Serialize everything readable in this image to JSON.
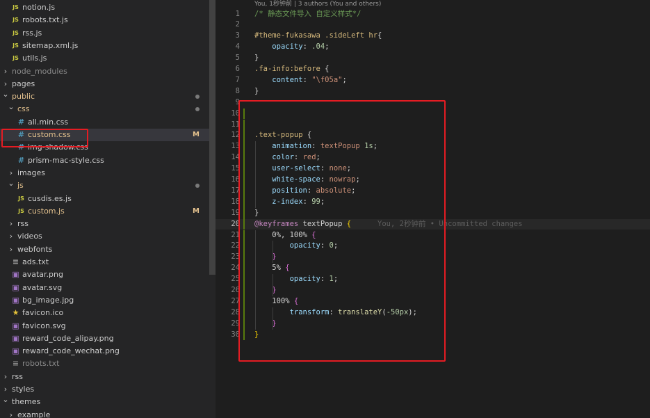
{
  "explorer": {
    "items": [
      {
        "type": "file",
        "depth": 1,
        "icon": "js-file-icon",
        "icon_text": "JS",
        "color": "#cbcb41",
        "label": "notion.js"
      },
      {
        "type": "file",
        "depth": 1,
        "icon": "js-file-icon",
        "icon_text": "JS",
        "color": "#cbcb41",
        "label": "robots.txt.js"
      },
      {
        "type": "file",
        "depth": 1,
        "icon": "js-file-icon",
        "icon_text": "JS",
        "color": "#cbcb41",
        "label": "rss.js"
      },
      {
        "type": "file",
        "depth": 1,
        "icon": "js-file-icon",
        "icon_text": "JS",
        "color": "#cbcb41",
        "label": "sitemap.xml.js"
      },
      {
        "type": "file",
        "depth": 1,
        "icon": "js-file-icon",
        "icon_text": "JS",
        "color": "#cbcb41",
        "label": "utils.js"
      },
      {
        "type": "folder",
        "depth": 0,
        "open": false,
        "label": "node_modules",
        "muted": true
      },
      {
        "type": "folder",
        "depth": 0,
        "open": false,
        "label": "pages"
      },
      {
        "type": "folder",
        "depth": 0,
        "open": true,
        "label": "public",
        "dot": true,
        "labelColor": "#e2c08d"
      },
      {
        "type": "folder",
        "depth": 1,
        "open": true,
        "label": "css",
        "dot": true,
        "labelColor": "#e2c08d"
      },
      {
        "type": "file",
        "depth": 2,
        "icon": "css-file-icon",
        "icon_text": "#",
        "color": "#519aba",
        "label": "all.min.css"
      },
      {
        "type": "file",
        "depth": 2,
        "icon": "css-file-icon",
        "icon_text": "#",
        "color": "#519aba",
        "label": "custom.css",
        "selected": true,
        "deco": "M",
        "labelColor": "#e2c08d"
      },
      {
        "type": "file",
        "depth": 2,
        "icon": "css-file-icon",
        "icon_text": "#",
        "color": "#519aba",
        "label": "img-shadow.css"
      },
      {
        "type": "file",
        "depth": 2,
        "icon": "css-file-icon",
        "icon_text": "#",
        "color": "#519aba",
        "label": "prism-mac-style.css"
      },
      {
        "type": "folder",
        "depth": 1,
        "open": false,
        "label": "images"
      },
      {
        "type": "folder",
        "depth": 1,
        "open": true,
        "label": "js",
        "dot": true,
        "labelColor": "#e2c08d"
      },
      {
        "type": "file",
        "depth": 2,
        "icon": "js-file-icon",
        "icon_text": "JS",
        "color": "#cbcb41",
        "label": "cusdis.es.js"
      },
      {
        "type": "file",
        "depth": 2,
        "icon": "js-file-icon",
        "icon_text": "JS",
        "color": "#cbcb41",
        "label": "custom.js",
        "deco": "M",
        "labelColor": "#e2c08d"
      },
      {
        "type": "folder",
        "depth": 1,
        "open": false,
        "label": "rss"
      },
      {
        "type": "folder",
        "depth": 1,
        "open": false,
        "label": "videos"
      },
      {
        "type": "folder",
        "depth": 1,
        "open": false,
        "label": "webfonts"
      },
      {
        "type": "file",
        "depth": 1,
        "icon": "text-file-icon",
        "icon_text": "≡",
        "color": "#aaaaaa",
        "label": "ads.txt"
      },
      {
        "type": "file",
        "depth": 1,
        "icon": "image-file-icon",
        "icon_text": "▣",
        "color": "#a074c4",
        "label": "avatar.png"
      },
      {
        "type": "file",
        "depth": 1,
        "icon": "image-file-icon",
        "icon_text": "▣",
        "color": "#a074c4",
        "label": "avatar.svg"
      },
      {
        "type": "file",
        "depth": 1,
        "icon": "image-file-icon",
        "icon_text": "▣",
        "color": "#a074c4",
        "label": "bg_image.jpg"
      },
      {
        "type": "file",
        "depth": 1,
        "icon": "favicon-star-icon",
        "icon_text": "★",
        "color": "#e6c33a",
        "label": "favicon.ico"
      },
      {
        "type": "file",
        "depth": 1,
        "icon": "image-file-icon",
        "icon_text": "▣",
        "color": "#a074c4",
        "label": "favicon.svg"
      },
      {
        "type": "file",
        "depth": 1,
        "icon": "image-file-icon",
        "icon_text": "▣",
        "color": "#a074c4",
        "label": "reward_code_alipay.png"
      },
      {
        "type": "file",
        "depth": 1,
        "icon": "image-file-icon",
        "icon_text": "▣",
        "color": "#a074c4",
        "label": "reward_code_wechat.png"
      },
      {
        "type": "file",
        "depth": 1,
        "icon": "text-file-icon",
        "icon_text": "≡",
        "color": "#8b8b8b",
        "label": "robots.txt",
        "muted": true
      },
      {
        "type": "folder",
        "depth": 0,
        "open": false,
        "label": "rss"
      },
      {
        "type": "folder",
        "depth": 0,
        "open": false,
        "label": "styles"
      },
      {
        "type": "folder",
        "depth": 0,
        "open": true,
        "label": "themes"
      },
      {
        "type": "folder",
        "depth": 1,
        "open": false,
        "label": "example"
      }
    ]
  },
  "editor": {
    "codelens": "You, 1秒钟前 | 3 authors (You and others)",
    "current_line": 20,
    "lines": [
      {
        "n": "1",
        "tokens": [
          [
            "/* 静态文件导入 自定义样式*/",
            "#6a9955"
          ]
        ]
      },
      {
        "n": "2",
        "tokens": []
      },
      {
        "n": "3",
        "tokens": [
          [
            "#theme-fukasawa .sideLeft ",
            "#d7ba7d"
          ],
          [
            "hr",
            "#d7ba7d"
          ],
          [
            "{",
            "#d4d4d4"
          ]
        ]
      },
      {
        "n": "4",
        "tokens": [
          [
            "    ",
            ""
          ],
          [
            "opacity",
            "#9cdcfe"
          ],
          [
            ": ",
            "#d4d4d4"
          ],
          [
            ".04",
            "#b5cea8"
          ],
          [
            ";",
            "#d4d4d4"
          ]
        ]
      },
      {
        "n": "5",
        "tokens": [
          [
            "}",
            "#d4d4d4"
          ]
        ]
      },
      {
        "n": "6",
        "tokens": [
          [
            ".fa-info",
            "#d7ba7d"
          ],
          [
            ":before",
            "#d7ba7d"
          ],
          [
            " {",
            "#d4d4d4"
          ]
        ]
      },
      {
        "n": "7",
        "tokens": [
          [
            "    ",
            ""
          ],
          [
            "content",
            "#9cdcfe"
          ],
          [
            ": ",
            "#d4d4d4"
          ],
          [
            "\"\\f05a\"",
            "#ce9178"
          ],
          [
            ";",
            "#d4d4d4"
          ]
        ]
      },
      {
        "n": "8",
        "tokens": [
          [
            "}",
            "#d4d4d4"
          ]
        ]
      },
      {
        "n": "9",
        "tokens": []
      },
      {
        "n": "10",
        "tokens": []
      },
      {
        "n": "11",
        "tokens": []
      },
      {
        "n": "12",
        "tokens": [
          [
            ".text-popup",
            "#d7ba7d"
          ],
          [
            " {",
            "#d4d4d4"
          ]
        ]
      },
      {
        "n": "13",
        "tokens": [
          [
            "    ",
            ""
          ],
          [
            "animation",
            "#9cdcfe"
          ],
          [
            ": ",
            "#d4d4d4"
          ],
          [
            "textPopup ",
            "#ce9178"
          ],
          [
            "1s",
            "#b5cea8"
          ],
          [
            ";",
            "#d4d4d4"
          ]
        ]
      },
      {
        "n": "14",
        "tokens": [
          [
            "    ",
            ""
          ],
          [
            "color",
            "#9cdcfe"
          ],
          [
            ": ",
            "#d4d4d4"
          ],
          [
            "red",
            "#ce9178"
          ],
          [
            ";",
            "#d4d4d4"
          ]
        ]
      },
      {
        "n": "15",
        "tokens": [
          [
            "    ",
            ""
          ],
          [
            "user-select",
            "#9cdcfe"
          ],
          [
            ": ",
            "#d4d4d4"
          ],
          [
            "none",
            "#ce9178"
          ],
          [
            ";",
            "#d4d4d4"
          ]
        ]
      },
      {
        "n": "16",
        "tokens": [
          [
            "    ",
            ""
          ],
          [
            "white-space",
            "#9cdcfe"
          ],
          [
            ": ",
            "#d4d4d4"
          ],
          [
            "nowrap",
            "#ce9178"
          ],
          [
            ";",
            "#d4d4d4"
          ]
        ]
      },
      {
        "n": "17",
        "tokens": [
          [
            "    ",
            ""
          ],
          [
            "position",
            "#9cdcfe"
          ],
          [
            ": ",
            "#d4d4d4"
          ],
          [
            "absolute",
            "#ce9178"
          ],
          [
            ";",
            "#d4d4d4"
          ]
        ]
      },
      {
        "n": "18",
        "tokens": [
          [
            "    ",
            ""
          ],
          [
            "z-index",
            "#9cdcfe"
          ],
          [
            ": ",
            "#d4d4d4"
          ],
          [
            "99",
            "#b5cea8"
          ],
          [
            ";",
            "#d4d4d4"
          ]
        ]
      },
      {
        "n": "19",
        "tokens": [
          [
            "}",
            "#d4d4d4"
          ]
        ]
      },
      {
        "n": "20",
        "tokens": [
          [
            "@keyframes",
            "#c586c0"
          ],
          [
            " textPopup ",
            "#d4d4d4"
          ],
          [
            "{",
            "#ffd700"
          ]
        ],
        "blame": "You, 2秒钟前 • Uncommitted changes"
      },
      {
        "n": "21",
        "tokens": [
          [
            "    ",
            ""
          ],
          [
            "0%, 100%",
            "#d4d4d4"
          ],
          [
            " {",
            "#da70d6"
          ]
        ]
      },
      {
        "n": "22",
        "tokens": [
          [
            "        ",
            ""
          ],
          [
            "opacity",
            "#9cdcfe"
          ],
          [
            ": ",
            "#d4d4d4"
          ],
          [
            "0",
            "#b5cea8"
          ],
          [
            ";",
            "#d4d4d4"
          ]
        ]
      },
      {
        "n": "23",
        "tokens": [
          [
            "    ",
            ""
          ],
          [
            "}",
            "#da70d6"
          ]
        ]
      },
      {
        "n": "24",
        "tokens": [
          [
            "    ",
            ""
          ],
          [
            "5%",
            "#d4d4d4"
          ],
          [
            " {",
            "#da70d6"
          ]
        ]
      },
      {
        "n": "25",
        "tokens": [
          [
            "        ",
            ""
          ],
          [
            "opacity",
            "#9cdcfe"
          ],
          [
            ": ",
            "#d4d4d4"
          ],
          [
            "1",
            "#b5cea8"
          ],
          [
            ";",
            "#d4d4d4"
          ]
        ]
      },
      {
        "n": "26",
        "tokens": [
          [
            "    ",
            ""
          ],
          [
            "}",
            "#da70d6"
          ]
        ]
      },
      {
        "n": "27",
        "tokens": [
          [
            "    ",
            ""
          ],
          [
            "100%",
            "#d4d4d4"
          ],
          [
            " {",
            "#da70d6"
          ]
        ]
      },
      {
        "n": "28",
        "tokens": [
          [
            "        ",
            ""
          ],
          [
            "transform",
            "#9cdcfe"
          ],
          [
            ": ",
            "#d4d4d4"
          ],
          [
            "translateY",
            "#dcdcaa"
          ],
          [
            "(",
            "#d4d4d4"
          ],
          [
            "-50px",
            "#b5cea8"
          ],
          [
            ");",
            "#d4d4d4"
          ]
        ]
      },
      {
        "n": "29",
        "tokens": [
          [
            "    ",
            ""
          ],
          [
            "}",
            "#da70d6"
          ]
        ]
      },
      {
        "n": "30",
        "tokens": [
          [
            "}",
            "#ffd700"
          ]
        ]
      }
    ]
  },
  "colors": {
    "highlight_box": "#e51c23",
    "modified_gutter": "#587c0c",
    "sidebar_bg": "#252526",
    "editor_bg": "#1e1e1e"
  }
}
